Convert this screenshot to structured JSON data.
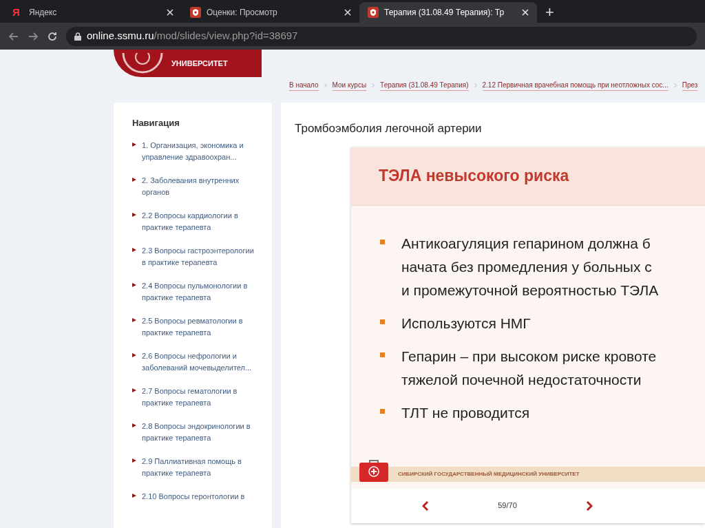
{
  "browser": {
    "tabs": [
      {
        "title": "Яндекс",
        "icon_letter": "Я",
        "selected": false
      },
      {
        "title": "Оценки: Просмотр",
        "selected": false
      },
      {
        "title": "Терапия (31.08.49 Терапия): Тр",
        "selected": true
      }
    ],
    "new_tab": "+",
    "address": {
      "host": "online.ssmu.ru",
      "path": "/mod/slides/view.php?id=38697"
    }
  },
  "header": {
    "logo_text": "УНИВЕРСИТЕТ"
  },
  "breadcrumbs": [
    "В начало",
    "Мои курсы",
    "Терапия (31.08.49 Терапия)",
    "2.12 Первичная врачебная помощь при неотложных сос...",
    "През"
  ],
  "navigation": {
    "title": "Навигация",
    "items": [
      "1. Организация, экономика и управление здравоохран...",
      "2. Заболевания внутренних органов",
      "2.2 Вопросы кардиологии в практике терапевта",
      "2.3 Вопросы гастроэнтерологии в практике терапевта",
      "2.4 Вопросы пульмонологии в практике терапевта",
      "2.5 Вопросы ревматологии в практике терапевта",
      "2.6 Вопросы нефрологии и заболеваний мочевыделител...",
      "2.7 Вопросы гематологии в практике терапевта",
      "2.8 Вопросы эндокринологии в практике терапевта",
      "2.9 Паллиативная помощь в практике терапевта",
      "2.10 Вопросы геронтологии в"
    ]
  },
  "main": {
    "title": "Тромбоэмболия легочной артерии",
    "slide": {
      "title": "ТЭЛА невысокого риска",
      "bullets": [
        {
          "lines": [
            "Антикоагуляция гепарином должна б",
            "начата без промедления у больных с",
            "и промежуточной вероятностью ТЭЛА"
          ]
        },
        {
          "lines": [
            "Используются НМГ"
          ]
        },
        {
          "lines": [
            "Гепарин – при высоком риске кровоте",
            "тяжелой почечной недостаточности"
          ]
        },
        {
          "lines": [
            "ТЛТ не проводится"
          ]
        }
      ],
      "footer": "СИБИРСКИЙ ГОСУДАРСТВЕННЫЙ МЕДИЦИНСКИЙ УНИВЕРСИТЕТ"
    },
    "pager": "59/70"
  }
}
